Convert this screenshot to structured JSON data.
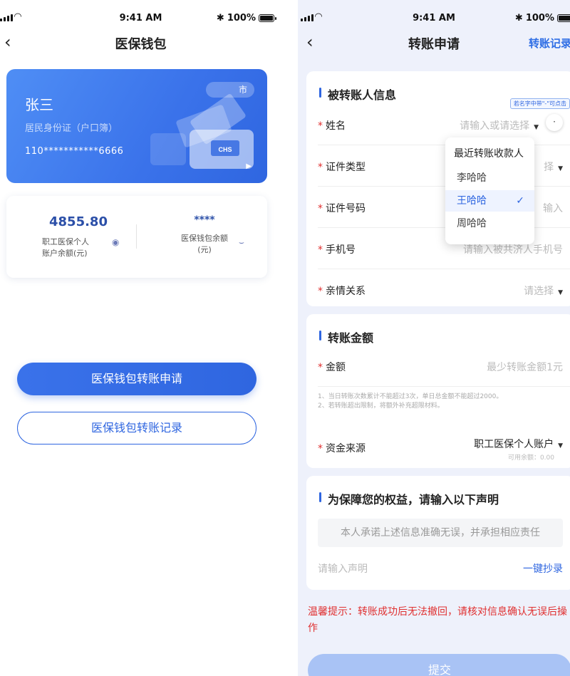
{
  "left": {
    "status": {
      "time": "9:41 AM",
      "battery": "100%"
    },
    "nav": {
      "title": "医保钱包"
    },
    "card": {
      "name": "张三",
      "doc_type": "居民身份证（户口簿）",
      "id_number": "110***********6666",
      "city": "市",
      "logo_text": "CHS"
    },
    "balance": {
      "personal_amount": "4855.80",
      "personal_label_line1": "职工医保个人",
      "personal_label_line2": "账户余额(元)",
      "wallet_amount": "****",
      "wallet_label_line1": "医保钱包余额",
      "wallet_label_line2": "(元)"
    },
    "actions": {
      "apply_label": "医保钱包转账申请",
      "records_label": "医保钱包转账记录"
    }
  },
  "right": {
    "status": {
      "time": "9:41 AM",
      "battery": "100%"
    },
    "nav": {
      "title": "转账申请",
      "records_link": "转账记录"
    },
    "payee": {
      "title": "被转账人信息",
      "hint_badge": "若名字中带\"-\"可点击",
      "fields": [
        {
          "label": "姓名",
          "placeholder": "请输入或请选择"
        },
        {
          "label": "证件类型",
          "placeholder": "择"
        },
        {
          "label": "证件号码",
          "placeholder": "输入"
        },
        {
          "label": "手机号",
          "placeholder": "请输入被共济人手机号"
        },
        {
          "label": "亲情关系",
          "placeholder": "请选择"
        }
      ]
    },
    "dropdown": {
      "header": "最近转账收款人",
      "options": [
        "李哈哈",
        "王哈哈",
        "周哈哈"
      ],
      "selected": "王哈哈"
    },
    "amount": {
      "title": "转账金额",
      "label": "金额",
      "placeholder": "最少转账金额1元",
      "note1": "1、当日转账次数累计不能超过3次，单日总金额不能超过2000。",
      "note2": "2、若转账超出限制，将额外补充超限材料。",
      "source_label": "资金来源",
      "source_value": "职工医保个人账户",
      "available": "可用余额：0.00"
    },
    "declaration": {
      "title": "为保障您的权益，请输入以下声明",
      "statement": "本人承诺上述信息准确无误，并承担相应责任",
      "input_placeholder": "请输入声明",
      "copy_label": "一键抄录"
    },
    "warning": "温馨提示：转账成功后无法撤回，请核对信息确认无误后操作",
    "submit_label": "提交"
  },
  "colors": {
    "accent": "#2f66e0",
    "danger": "#e03030",
    "page_bg": "#eef1fb"
  }
}
